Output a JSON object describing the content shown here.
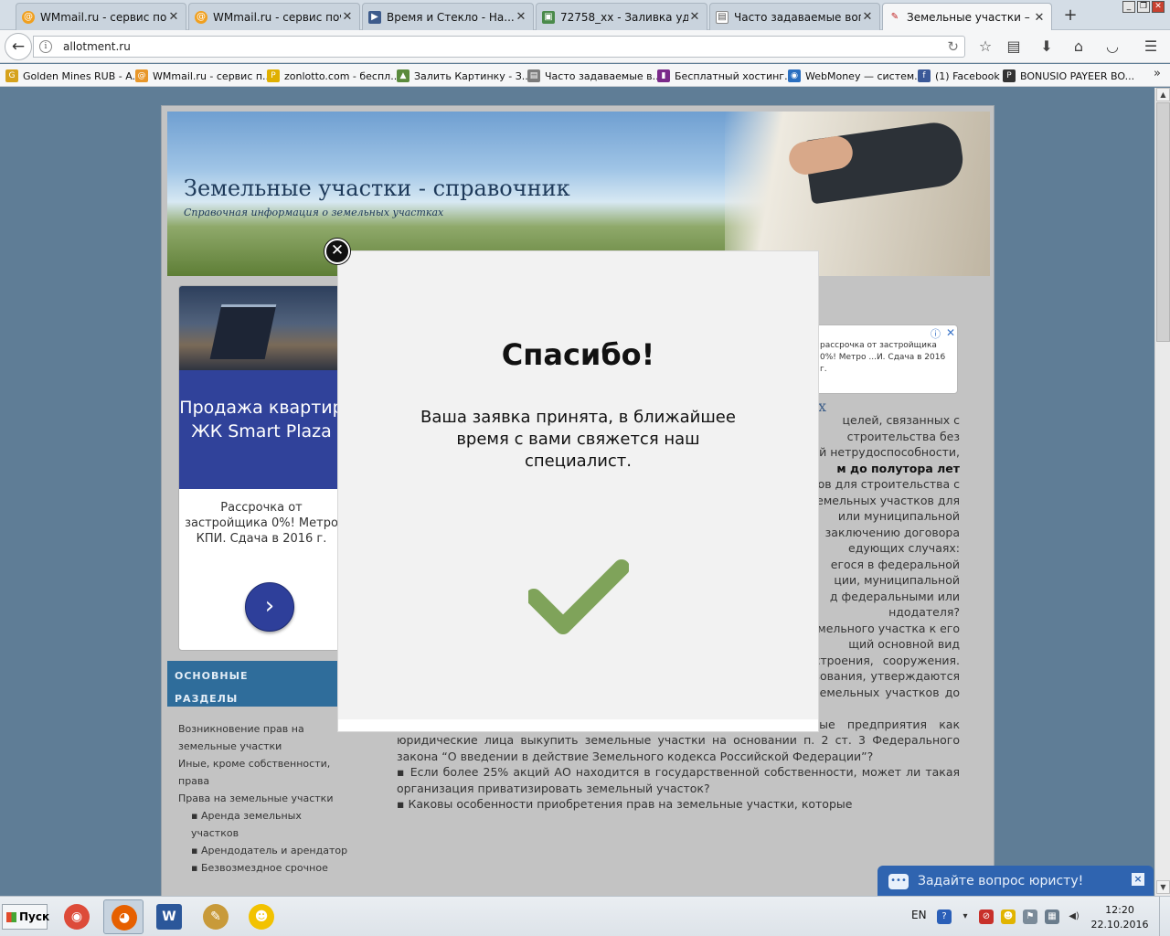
{
  "browser": {
    "tabs": [
      {
        "title": "WMmail.ru - сервис почт...",
        "icon": "wmmail-icon",
        "active": false
      },
      {
        "title": "WMmail.ru - сервис почт...",
        "icon": "wmmail-icon",
        "active": false
      },
      {
        "title": "Время и Стекло - На...",
        "icon": "video-icon",
        "active": false
      },
      {
        "title": "72758_xx - Заливка уда...",
        "icon": "image-icon",
        "active": false
      },
      {
        "title": "Часто задаваемые вопр...",
        "icon": "page-icon",
        "active": false
      },
      {
        "title": "Земельные участки – ю...",
        "icon": "pen-icon",
        "active": true
      }
    ],
    "new_tab": "+",
    "url": "allotment.ru",
    "window_buttons": [
      "_",
      "❐",
      "✕"
    ]
  },
  "bookmarks": [
    {
      "label": "Golden Mines RUB - A...",
      "icon_color": "#d6a21c",
      "glyph": "G"
    },
    {
      "label": "WMmail.ru - сервис п...",
      "icon_color": "#e8972a",
      "glyph": "@"
    },
    {
      "label": "zonlotto.com - беспл...",
      "icon_color": "#e0b000",
      "glyph": "P"
    },
    {
      "label": "Залить Картинку - З...",
      "icon_color": "#5a8a3c",
      "glyph": "▲"
    },
    {
      "label": "Часто задаваемые в...",
      "icon_color": "#7c7c7c",
      "glyph": "▤"
    },
    {
      "label": "Бесплатный хостинг...",
      "icon_color": "#7a2a8a",
      "glyph": "▮"
    },
    {
      "label": "WebMoney — систем...",
      "icon_color": "#2a6fc0",
      "glyph": "◉"
    },
    {
      "label": "(1) Facebook",
      "icon_color": "#3b5998",
      "glyph": "f"
    },
    {
      "label": "BONUSIO PAYEER BO...",
      "icon_color": "#333333",
      "glyph": "P"
    }
  ],
  "site": {
    "title": "Земельные участки - справочник",
    "subtitle": "Справочная информация о земельных участках",
    "ad": {
      "title": "Продажа квартир ЖК Smart Plaza",
      "text": "Рассрочка от застройщика 0%! Метро КПИ. Сдача в 2016 г.",
      "arrow": "›"
    },
    "sidebar": {
      "heading_1": "ОСНОВНЫЕ",
      "heading_2": "РАЗДЕЛЫ",
      "links": [
        {
          "text": "Возникновение прав на земельные участки",
          "indent": false
        },
        {
          "text": "Иные, кроме собственности, права",
          "indent": false
        },
        {
          "text": "Права на земельные участки",
          "indent": false
        },
        {
          "text": "▪ Аренда земельных участков",
          "indent": true
        },
        {
          "text": "▪ Арендодатель и арендатор",
          "indent": true
        },
        {
          "text": "▪ Безвозмездное срочное",
          "indent": true
        }
      ]
    },
    "right_ad_text": "рассрочка от застройщика 0%! Метро ...И. Сдача в 2016 г.",
    "content_link": "х",
    "content_lines": [
      "целей, связанных с",
      "строительства без",
      "ой нетрудоспособности,",
      "м до полутора лет",
      "ов для строительства с",
      "емельных участков для",
      "или муниципальной",
      "заключению договора",
      "едующих случаях:",
      "егося в федеральной",
      "ции, муниципальной",
      "д федеральными или",
      "ндодателя?",
      "емельного участка к его",
      "щий основной вид",
      "использования расположенных на земельном участке здания, строения, сооружения. Поправочные коэффициенты, учитывающие основные виды использования, утверждаются Правительством РФ в размере от 0,7 до 1,3. Возможен ли выкуп земельных участков до принятия Правительством РФ соответствующих коэффициентов?",
      "▪ Вправе ли государственные или муниципальные унитарные предприятия как юридические лица выкупить земельные участки на основании п. 2 ст. 3 Федерального закона “О введении в действие Земельного кодекса Российской Федерации”?",
      "▪ Если более 25% акций АО находится в государственной собственности, может ли такая организация приватизировать земельный участок?",
      "▪ Каковы особенности приобретения прав на земельные участки, которые"
    ]
  },
  "modal": {
    "close": "✕",
    "title": "Спасибо!",
    "message": "Ваша заявка принята, в ближайшее время с вами свяжется наш специалист.",
    "check_color": "#7fa35a"
  },
  "chat": {
    "label": "Задайте вопрос юристу!",
    "close": "×"
  },
  "taskbar": {
    "start_label": "Пуск",
    "apps": [
      {
        "name": "chrome-app",
        "color": "#dd4b39",
        "glyph": "◉",
        "active": false
      },
      {
        "name": "firefox-app",
        "color": "#e66000",
        "glyph": "◕",
        "active": true
      },
      {
        "name": "word-app",
        "color": "#2b579a",
        "glyph": "W",
        "active": false
      },
      {
        "name": "paint-app",
        "color": "#c89a3a",
        "glyph": "✎",
        "active": false
      },
      {
        "name": "cyberghost-app",
        "color": "#f2c200",
        "glyph": "☻",
        "active": false
      }
    ],
    "language": "EN",
    "time": "12:20",
    "date": "22.10.2016"
  }
}
